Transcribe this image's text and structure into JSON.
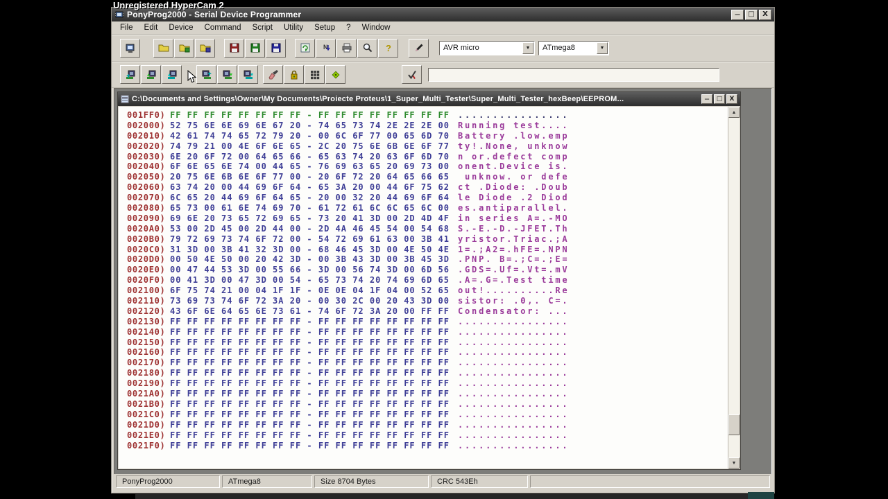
{
  "hypercam_title": "Unregistered HyperCam 2",
  "main_window": {
    "title": "PonyProg2000 - Serial Device Programmer",
    "minimize_glyph": "—",
    "maximize_glyph": "□",
    "close_glyph": "X"
  },
  "menu": {
    "items": [
      "File",
      "Edit",
      "Device",
      "Command",
      "Script",
      "Utility",
      "Setup",
      "?",
      "Window"
    ]
  },
  "toolbar_main": {
    "button_groups": [
      [
        "exit"
      ],
      [
        "open-device-file",
        "open-program-file",
        "open-data-file"
      ],
      [
        "save-device-file",
        "save-program-file",
        "save-data-file"
      ],
      [
        "reload-files",
        "serial-number",
        "print-buffer",
        "magnify",
        "help"
      ],
      [
        "edit-buffer"
      ]
    ],
    "device_family": "AVR micro",
    "device_model": "ATmega8"
  },
  "toolbar_commands": {
    "button_groups": [
      [
        "read-device",
        "read-program",
        "read-data"
      ],
      [
        "write-device",
        "write-program",
        "write-data"
      ],
      [
        "erase-device",
        "security-bits",
        "fuse-bits",
        "oscillator"
      ],
      [
        "verify"
      ]
    ]
  },
  "child_window": {
    "title": "C:\\Documents and Settings\\Owner\\My Documents\\Proiecte Proteus\\1_Super_Multi_Tester\\Super_Multi_Tester_hexBeep\\EEPROM...",
    "minimize_glyph": "—",
    "maximize_glyph": "□",
    "close_glyph": "X"
  },
  "hex_view": {
    "rows": [
      {
        "addr": "001FF0)",
        "bytes": "FF FF FF FF FF FF FF FF - FF FF FF FF FF FF FF FF",
        "ascii": "................",
        "section": "flash"
      },
      {
        "addr": "002000)",
        "bytes": "52 75 6E 6E 69 6E 67 20 - 74 65 73 74 2E 2E 2E 00",
        "ascii": "Running test....",
        "section": "eeprom"
      },
      {
        "addr": "002010)",
        "bytes": "42 61 74 74 65 72 79 20 - 00 6C 6F 77 00 65 6D 70",
        "ascii": "Battery .low.emp",
        "section": "eeprom"
      },
      {
        "addr": "002020)",
        "bytes": "74 79 21 00 4E 6F 6E 65 - 2C 20 75 6E 6B 6E 6F 77",
        "ascii": "ty!.None, unknow",
        "section": "eeprom"
      },
      {
        "addr": "002030)",
        "bytes": "6E 20 6F 72 00 64 65 66 - 65 63 74 20 63 6F 6D 70",
        "ascii": "n or.defect comp",
        "section": "eeprom"
      },
      {
        "addr": "002040)",
        "bytes": "6F 6E 65 6E 74 00 44 65 - 76 69 63 65 20 69 73 00",
        "ascii": "onent.Device is.",
        "section": "eeprom"
      },
      {
        "addr": "002050)",
        "bytes": "20 75 6E 6B 6E 6F 77 00 - 20 6F 72 20 64 65 66 65",
        "ascii": " unknow. or defe",
        "section": "eeprom"
      },
      {
        "addr": "002060)",
        "bytes": "63 74 20 00 44 69 6F 64 - 65 3A 20 00 44 6F 75 62",
        "ascii": "ct .Diode: .Doub",
        "section": "eeprom"
      },
      {
        "addr": "002070)",
        "bytes": "6C 65 20 44 69 6F 64 65 - 20 00 32 20 44 69 6F 64",
        "ascii": "le Diode .2 Diod",
        "section": "eeprom"
      },
      {
        "addr": "002080)",
        "bytes": "65 73 00 61 6E 74 69 70 - 61 72 61 6C 6C 65 6C 00",
        "ascii": "es.antiparallel.",
        "section": "eeprom"
      },
      {
        "addr": "002090)",
        "bytes": "69 6E 20 73 65 72 69 65 - 73 20 41 3D 00 2D 4D 4F",
        "ascii": "in series A=.-MO",
        "section": "eeprom"
      },
      {
        "addr": "0020A0)",
        "bytes": "53 00 2D 45 00 2D 44 00 - 2D 4A 46 45 54 00 54 68",
        "ascii": "S.-E.-D.-JFET.Th",
        "section": "eeprom"
      },
      {
        "addr": "0020B0)",
        "bytes": "79 72 69 73 74 6F 72 00 - 54 72 69 61 63 00 3B 41",
        "ascii": "yristor.Triac.;A",
        "section": "eeprom"
      },
      {
        "addr": "0020C0)",
        "bytes": "31 3D 00 3B 41 32 3D 00 - 68 46 45 3D 00 4E 50 4E",
        "ascii": "1=.;A2=.hFE=.NPN",
        "section": "eeprom"
      },
      {
        "addr": "0020D0)",
        "bytes": "00 50 4E 50 00 20 42 3D - 00 3B 43 3D 00 3B 45 3D",
        "ascii": ".PNP. B=.;C=.;E=",
        "section": "eeprom"
      },
      {
        "addr": "0020E0)",
        "bytes": "00 47 44 53 3D 00 55 66 - 3D 00 56 74 3D 00 6D 56",
        "ascii": ".GDS=.Uf=.Vt=.mV",
        "section": "eeprom"
      },
      {
        "addr": "0020F0)",
        "bytes": "00 41 3D 00 47 3D 00 54 - 65 73 74 20 74 69 6D 65",
        "ascii": ".A=.G=.Test time",
        "section": "eeprom"
      },
      {
        "addr": "002100)",
        "bytes": "6F 75 74 21 00 04 1F 1F - 0E 0E 04 1F 04 00 52 65",
        "ascii": "out!..........Re",
        "section": "eeprom"
      },
      {
        "addr": "002110)",
        "bytes": "73 69 73 74 6F 72 3A 20 - 00 30 2C 00 20 43 3D 00",
        "ascii": "sistor: .0,. C=.",
        "section": "eeprom"
      },
      {
        "addr": "002120)",
        "bytes": "43 6F 6E 64 65 6E 73 61 - 74 6F 72 3A 20 00 FF FF",
        "ascii": "Condensator: ...",
        "section": "eeprom"
      },
      {
        "addr": "002130)",
        "bytes": "FF FF FF FF FF FF FF FF - FF FF FF FF FF FF FF FF",
        "ascii": "................",
        "section": "eeprom"
      },
      {
        "addr": "002140)",
        "bytes": "FF FF FF FF FF FF FF FF - FF FF FF FF FF FF FF FF",
        "ascii": "................",
        "section": "eeprom"
      },
      {
        "addr": "002150)",
        "bytes": "FF FF FF FF FF FF FF FF - FF FF FF FF FF FF FF FF",
        "ascii": "................",
        "section": "eeprom"
      },
      {
        "addr": "002160)",
        "bytes": "FF FF FF FF FF FF FF FF - FF FF FF FF FF FF FF FF",
        "ascii": "................",
        "section": "eeprom"
      },
      {
        "addr": "002170)",
        "bytes": "FF FF FF FF FF FF FF FF - FF FF FF FF FF FF FF FF",
        "ascii": "................",
        "section": "eeprom"
      },
      {
        "addr": "002180)",
        "bytes": "FF FF FF FF FF FF FF FF - FF FF FF FF FF FF FF FF",
        "ascii": "................",
        "section": "eeprom"
      },
      {
        "addr": "002190)",
        "bytes": "FF FF FF FF FF FF FF FF - FF FF FF FF FF FF FF FF",
        "ascii": "................",
        "section": "eeprom"
      },
      {
        "addr": "0021A0)",
        "bytes": "FF FF FF FF FF FF FF FF - FF FF FF FF FF FF FF FF",
        "ascii": "................",
        "section": "eeprom"
      },
      {
        "addr": "0021B0)",
        "bytes": "FF FF FF FF FF FF FF FF - FF FF FF FF FF FF FF FF",
        "ascii": "................",
        "section": "eeprom"
      },
      {
        "addr": "0021C0)",
        "bytes": "FF FF FF FF FF FF FF FF - FF FF FF FF FF FF FF FF",
        "ascii": "................",
        "section": "eeprom"
      },
      {
        "addr": "0021D0)",
        "bytes": "FF FF FF FF FF FF FF FF - FF FF FF FF FF FF FF FF",
        "ascii": "................",
        "section": "eeprom"
      },
      {
        "addr": "0021E0)",
        "bytes": "FF FF FF FF FF FF FF FF - FF FF FF FF FF FF FF FF",
        "ascii": "................",
        "section": "eeprom"
      },
      {
        "addr": "0021F0)",
        "bytes": "FF FF FF FF FF FF FF FF - FF FF FF FF FF FF FF FF",
        "ascii": "................",
        "section": "eeprom"
      }
    ]
  },
  "statusbar": {
    "app_name": "PonyProg2000",
    "device": "ATmega8",
    "size": "Size  8704 Bytes",
    "crc": "CRC  543Eh"
  },
  "colors": {
    "address": "#9e3232",
    "flash_hex": "#2e8b2e",
    "flash_ascii": "#3a3a6e",
    "eeprom_hex": "#3e3e96",
    "eeprom_ascii": "#9a3a9a"
  }
}
